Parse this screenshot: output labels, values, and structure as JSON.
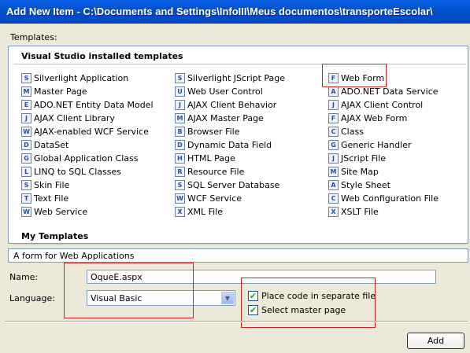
{
  "window": {
    "title": "Add New Item - C:\\Documents and Settings\\InfoIII\\Meus documentos\\transporteEscolar\\"
  },
  "templates_label": "Templates:",
  "groups": {
    "installed": "Visual Studio installed templates",
    "my": "My Templates"
  },
  "templates": {
    "col1": [
      {
        "label": "Silverlight Application",
        "icon": "silverlight-icon",
        "glyph": "S"
      },
      {
        "label": "Master Page",
        "icon": "master-page-icon",
        "glyph": "M"
      },
      {
        "label": "ADO.NET Entity Data Model",
        "icon": "entity-model-icon",
        "glyph": "E"
      },
      {
        "label": "AJAX Client Library",
        "icon": "ajax-library-icon",
        "glyph": "J"
      },
      {
        "label": "AJAX-enabled WCF Service",
        "icon": "wcf-service-icon",
        "glyph": "W"
      },
      {
        "label": "DataSet",
        "icon": "dataset-icon",
        "glyph": "D"
      },
      {
        "label": "Global Application Class",
        "icon": "global-class-icon",
        "glyph": "G"
      },
      {
        "label": "LINQ to SQL Classes",
        "icon": "linq-icon",
        "glyph": "L"
      },
      {
        "label": "Skin File",
        "icon": "skin-file-icon",
        "glyph": "S"
      },
      {
        "label": "Text File",
        "icon": "text-file-icon",
        "glyph": "T"
      },
      {
        "label": "Web Service",
        "icon": "web-service-icon",
        "glyph": "W"
      }
    ],
    "col2": [
      {
        "label": "Silverlight JScript Page",
        "icon": "silverlight-jscript-icon",
        "glyph": "S"
      },
      {
        "label": "Web User Control",
        "icon": "user-control-icon",
        "glyph": "U"
      },
      {
        "label": "AJAX Client Behavior",
        "icon": "ajax-behavior-icon",
        "glyph": "J"
      },
      {
        "label": "AJAX Master Page",
        "icon": "ajax-master-icon",
        "glyph": "M"
      },
      {
        "label": "Browser File",
        "icon": "browser-file-icon",
        "glyph": "B"
      },
      {
        "label": "Dynamic Data Field",
        "icon": "dynamic-data-icon",
        "glyph": "D"
      },
      {
        "label": "HTML Page",
        "icon": "html-page-icon",
        "glyph": "H"
      },
      {
        "label": "Resource File",
        "icon": "resource-file-icon",
        "glyph": "R"
      },
      {
        "label": "SQL Server Database",
        "icon": "database-icon",
        "glyph": "S"
      },
      {
        "label": "WCF Service",
        "icon": "wcf-icon",
        "glyph": "W"
      },
      {
        "label": "XML File",
        "icon": "xml-file-icon",
        "glyph": "X"
      }
    ],
    "col3": [
      {
        "label": "Web Form",
        "icon": "web-form-icon",
        "glyph": "F"
      },
      {
        "label": "ADO.NET Data Service",
        "icon": "data-service-icon",
        "glyph": "A"
      },
      {
        "label": "AJAX Client Control",
        "icon": "ajax-control-icon",
        "glyph": "J"
      },
      {
        "label": "AJAX Web Form",
        "icon": "ajax-web-form-icon",
        "glyph": "F"
      },
      {
        "label": "Class",
        "icon": "class-icon",
        "glyph": "C"
      },
      {
        "label": "Generic Handler",
        "icon": "generic-handler-icon",
        "glyph": "G"
      },
      {
        "label": "JScript File",
        "icon": "jscript-file-icon",
        "glyph": "J"
      },
      {
        "label": "Site Map",
        "icon": "site-map-icon",
        "glyph": "M"
      },
      {
        "label": "Style Sheet",
        "icon": "style-sheet-icon",
        "glyph": "A"
      },
      {
        "label": "Web Configuration File",
        "icon": "web-config-icon",
        "glyph": "C"
      },
      {
        "label": "XSLT File",
        "icon": "xslt-file-icon",
        "glyph": "X"
      }
    ]
  },
  "description": "A form for Web Applications",
  "name": {
    "label": "Name:",
    "value": "OqueE.aspx"
  },
  "language": {
    "label": "Language:",
    "value": "Visual Basic"
  },
  "options": {
    "separate_file": "Place code in separate file",
    "master_page": "Select master page",
    "separate_checked": true,
    "master_checked": true
  },
  "buttons": {
    "add": "Add"
  },
  "colors": {
    "title_bar": "#0052cc",
    "dialog_bg": "#ece9d8",
    "highlight_box": "#d42020"
  }
}
